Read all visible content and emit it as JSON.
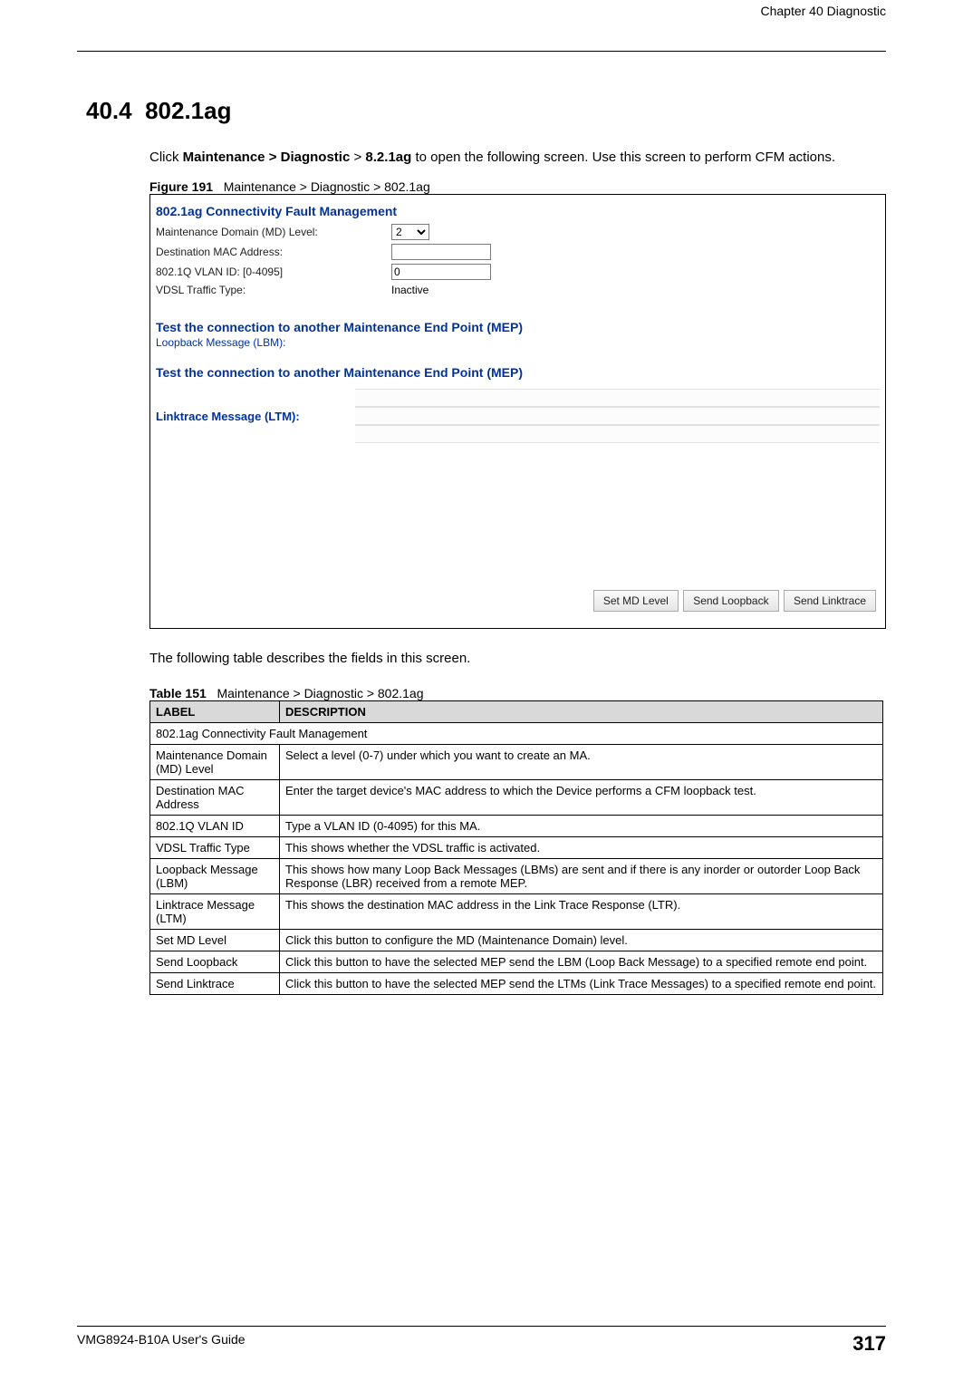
{
  "header": {
    "chapter": "Chapter 40 Diagnostic"
  },
  "section": {
    "number": "40.4",
    "title": "802.1ag",
    "intro_pre": "Click ",
    "intro_b1": "Maintenance > Diagnostic",
    "intro_mid": " > ",
    "intro_b2": "8.2.1ag",
    "intro_post": " to open the following screen. Use this screen to perform CFM actions."
  },
  "figure": {
    "label": "Figure 191",
    "caption": "Maintenance > Diagnostic > 802.1ag"
  },
  "screenshot": {
    "title": "802.1ag Connectivity Fault Management",
    "md_level_label": "Maintenance Domain (MD) Level:",
    "md_level_value": "2",
    "dest_mac_label": "Destination MAC Address:",
    "dest_mac_value": "",
    "vlan_label": "802.1Q VLAN ID: [0-4095]",
    "vlan_value": "0",
    "vdsl_label": "VDSL Traffic Type:",
    "vdsl_value": "Inactive",
    "mep_head1": "Test the connection to another Maintenance End Point (MEP)",
    "lbm_label": "Loopback Message (LBM):",
    "mep_head2": "Test the connection to another Maintenance End Point (MEP)",
    "ltm_label": "Linktrace Message (LTM):",
    "btn_set": "Set MD Level",
    "btn_loop": "Send Loopback",
    "btn_link": "Send Linktrace"
  },
  "table_intro": "The following table describes the fields in this screen.",
  "table_caption": {
    "label": "Table 151",
    "caption": "Maintenance > Diagnostic > 802.1ag"
  },
  "table": {
    "h_label": "LABEL",
    "h_desc": "DESCRIPTION",
    "section_row": "802.1ag Connectivity Fault Management",
    "rows": [
      {
        "label": "Maintenance Domain (MD) Level",
        "desc": "Select a level (0-7) under which you want to create an MA."
      },
      {
        "label": "Destination MAC Address",
        "desc": "Enter the target device's MAC address to which the Device performs a CFM loopback test."
      },
      {
        "label": "802.1Q VLAN ID",
        "desc": "Type a VLAN ID (0-4095) for this MA."
      },
      {
        "label": "VDSL Traffic Type",
        "desc": "This shows whether the VDSL traffic is activated."
      },
      {
        "label": "Loopback Message (LBM)",
        "desc": "This shows how many Loop Back Messages (LBMs) are sent and if there is any inorder or outorder Loop Back Response (LBR) received from a remote MEP."
      },
      {
        "label": "Linktrace Message (LTM)",
        "desc": "This shows the destination MAC address in the Link Trace Response (LTR)."
      },
      {
        "label": "Set MD Level",
        "desc": "Click this button to configure the MD (Maintenance Domain) level."
      },
      {
        "label": "Send Loopback",
        "desc": "Click this button to have the selected MEP send the LBM (Loop Back Message) to a specified remote end point."
      },
      {
        "label": "Send Linktrace",
        "desc": "Click this button to have the selected MEP send the LTMs (Link Trace Messages) to a specified remote end point."
      }
    ]
  },
  "footer": {
    "guide": "VMG8924-B10A User's Guide",
    "page": "317"
  }
}
